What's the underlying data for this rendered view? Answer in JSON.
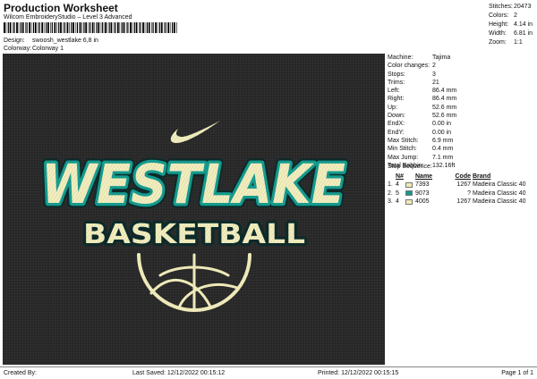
{
  "header": {
    "title": "Production Worksheet",
    "subtitle": "Wilcom EmbroideryStudio – Level 3 Advanced",
    "design_label": "Design:",
    "design_value": "swoosh_westlake 6,8 in",
    "colorway_label": "Colorway:",
    "colorway_value": "Colorway 1"
  },
  "stats": [
    {
      "label": "Stitches:",
      "value": "20473"
    },
    {
      "label": "Colors:",
      "value": "2"
    },
    {
      "label": "Height:",
      "value": "4.14 in"
    },
    {
      "label": "Width:",
      "value": "6.81 in"
    },
    {
      "label": "Zoom:",
      "value": "1:1"
    }
  ],
  "design": {
    "line1": "WESTLAKE",
    "line2": "BASKETBALL",
    "colors": {
      "background": "#272727",
      "fill": "#f2eec0",
      "outline": "#159a8e",
      "shadow": "#0d2a2a"
    }
  },
  "properties": [
    {
      "label": "Machine:",
      "value": "Tajima"
    },
    {
      "label": "Color changes:",
      "value": "2"
    },
    {
      "label": "Stops:",
      "value": "3"
    },
    {
      "label": "Trims:",
      "value": "21"
    },
    {
      "label": "Left:",
      "value": "86.4 mm"
    },
    {
      "label": "Right:",
      "value": "86.4 mm"
    },
    {
      "label": "Up:",
      "value": "52.6 mm"
    },
    {
      "label": "Down:",
      "value": "52.6 mm"
    },
    {
      "label": "EndX:",
      "value": "0.00 in"
    },
    {
      "label": "EndY:",
      "value": "0.00 in"
    },
    {
      "label": "Max Stitch:",
      "value": "6.9 mm"
    },
    {
      "label": "Min Stitch:",
      "value": "0.4 mm"
    },
    {
      "label": "Max Jump:",
      "value": "7.1 mm"
    },
    {
      "label": "Total Bobbin:",
      "value": "132.16ft"
    }
  ],
  "stop_sequence": {
    "title": "Stop Sequence:",
    "headers": {
      "n": "N#",
      "name": "Name",
      "code": "Code",
      "brand": "Brand"
    },
    "rows": [
      {
        "idx": "1.",
        "n": "4",
        "swatch": "#eeeab5",
        "name": "7393",
        "code": "1267",
        "brand": "Madeira Classic 40"
      },
      {
        "idx": "2.",
        "n": "5",
        "swatch": "#12998d",
        "name": "9073",
        "code": "?",
        "brand": "Madeira Classic 40"
      },
      {
        "idx": "3.",
        "n": "4",
        "swatch": "#eeeab5",
        "name": "4005",
        "code": "1267",
        "brand": "Madeira Classic 40"
      }
    ]
  },
  "footer": {
    "created": "Created By:",
    "saved": "Last Saved: 12/12/2022 00:15:12",
    "printed": "Printed: 12/12/2022 00:15:15",
    "page": "Page 1 of 1"
  }
}
